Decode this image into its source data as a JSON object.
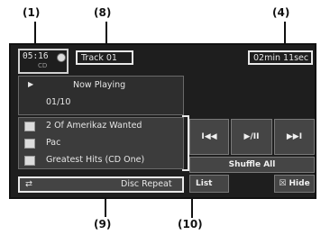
{
  "callouts": {
    "c1": "(1)",
    "c8": "(8)",
    "c4": "(4)",
    "c9": "(9)",
    "c10": "(10)"
  },
  "clock": "05:16",
  "cd_label": "CD",
  "track": "Track  01",
  "time": "02min  11sec",
  "now_playing": "Now Playing",
  "track_count": "01/10",
  "song": "2 Of Amerikaz Wanted",
  "artist": "Pac",
  "album": "Greatest Hits (CD One)",
  "repeat": "Disc Repeat",
  "controls": {
    "prev": "I◀◀",
    "play": "▶/II",
    "next": "▶▶I"
  },
  "shuffle": "Shuffle All",
  "list": "List",
  "hide": "☒ Hide"
}
